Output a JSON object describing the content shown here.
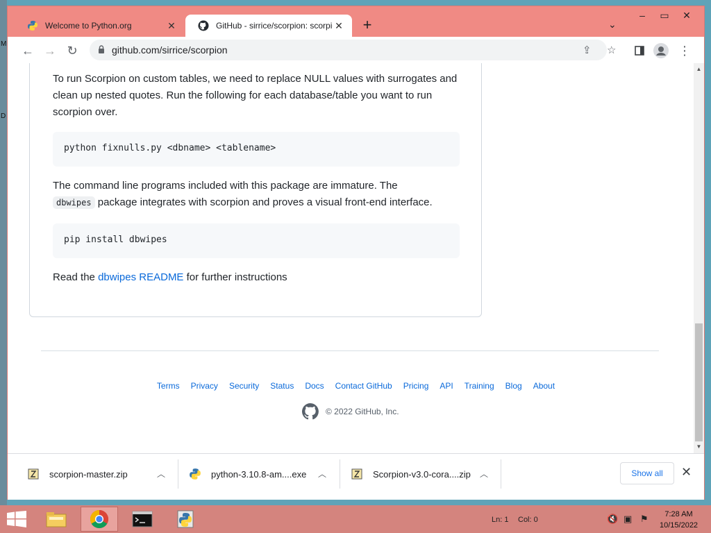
{
  "browser": {
    "tabs": [
      {
        "title": "Welcome to Python.org",
        "active": false
      },
      {
        "title": "GitHub - sirrice/scorpion: scorpion",
        "active": true
      }
    ],
    "url": "github.com/sirrice/scorpion"
  },
  "readme": {
    "para1": "To run Scorpion on custom tables, we need to replace NULL values with surrogates and clean up nested quotes. Run the following for each database/table you want to run scorpion over.",
    "code1": "python fixnulls.py <dbname> <tablename>",
    "para2_before": "The command line programs included with this package are immature. The",
    "para2_code": "dbwipes",
    "para2_after": "package integrates with scorpion and proves a visual front-end interface.",
    "code2": "pip install dbwipes",
    "para3_before": "Read the",
    "para3_link": "dbwipes README",
    "para3_after": "for further instructions"
  },
  "footer": {
    "links": [
      "Terms",
      "Privacy",
      "Security",
      "Status",
      "Docs",
      "Contact GitHub",
      "Pricing",
      "API",
      "Training",
      "Blog",
      "About"
    ],
    "copyright": "© 2022 GitHub, Inc."
  },
  "downloads": {
    "items": [
      {
        "name": "scorpion-master.zip",
        "icon": "zip-archive-icon"
      },
      {
        "name": "python-3.10.8-am....exe",
        "icon": "python-installer-icon"
      },
      {
        "name": "Scorpion-v3.0-cora....zip",
        "icon": "zip-archive-icon"
      }
    ],
    "show_all": "Show all"
  },
  "taskbar": {
    "status_line": "Ln: 1",
    "status_col": "Col: 0",
    "time": "7:28 AM",
    "date": "10/15/2022"
  },
  "desktop": {
    "edge_letters": [
      "M",
      "D"
    ]
  }
}
